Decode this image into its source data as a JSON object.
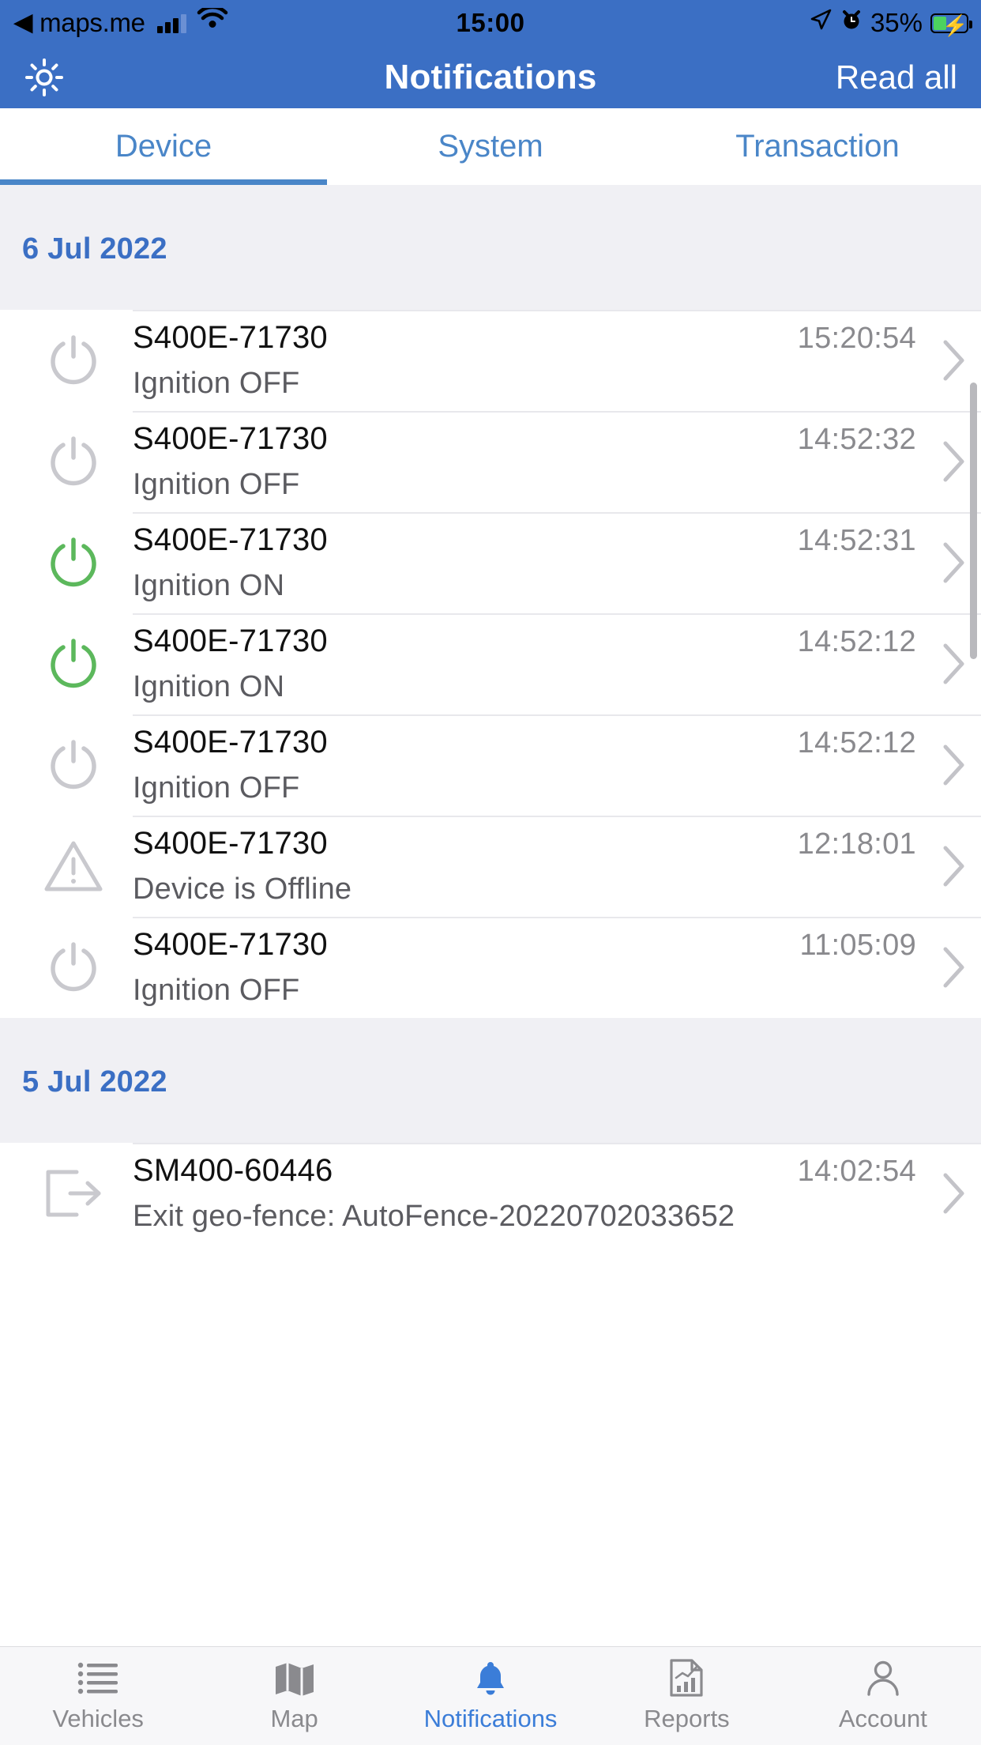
{
  "status_bar": {
    "back_arrow": "◀",
    "carrier_app": "maps.me",
    "signal_icon": "cellular-signal-icon",
    "wifi_icon": "wifi-icon",
    "time": "15:00",
    "location_icon": "location-arrow-icon",
    "alarm_icon": "alarm-clock-icon",
    "battery_percent": "35%",
    "battery_icon": "battery-charging-icon"
  },
  "nav_bar": {
    "settings_icon": "gear-icon",
    "title": "Notifications",
    "action_label": "Read all"
  },
  "tabs": [
    {
      "label": "Device",
      "active": true
    },
    {
      "label": "System",
      "active": false
    },
    {
      "label": "Transaction",
      "active": false
    }
  ],
  "sections": [
    {
      "date": "6 Jul 2022",
      "rows": [
        {
          "icon": "power-off-icon",
          "icon_color": "#c9c9ce",
          "device": "S400E-71730",
          "event": "Ignition OFF",
          "time": "15:20:54"
        },
        {
          "icon": "power-off-icon",
          "icon_color": "#c9c9ce",
          "device": "S400E-71730",
          "event": "Ignition OFF",
          "time": "14:52:32"
        },
        {
          "icon": "power-on-icon",
          "icon_color": "#5cb85c",
          "device": "S400E-71730",
          "event": "Ignition ON",
          "time": "14:52:31"
        },
        {
          "icon": "power-on-icon",
          "icon_color": "#5cb85c",
          "device": "S400E-71730",
          "event": "Ignition ON",
          "time": "14:52:12"
        },
        {
          "icon": "power-off-icon",
          "icon_color": "#c9c9ce",
          "device": "S400E-71730",
          "event": "Ignition OFF",
          "time": "14:52:12"
        },
        {
          "icon": "warning-icon",
          "icon_color": "#c9c9ce",
          "device": "S400E-71730",
          "event": "Device is Offline",
          "time": "12:18:01"
        },
        {
          "icon": "power-off-icon",
          "icon_color": "#c9c9ce",
          "device": "S400E-71730",
          "event": "Ignition OFF",
          "time": "11:05:09"
        }
      ]
    },
    {
      "date": "5 Jul 2022",
      "rows": [
        {
          "icon": "exit-geofence-icon",
          "icon_color": "#c9c9ce",
          "device": "SM400-60446",
          "event": "Exit geo-fence: AutoFence-20220702033652",
          "time": "14:02:54"
        }
      ]
    }
  ],
  "bottom_bar": [
    {
      "label": "Vehicles",
      "icon": "list-icon",
      "active": false
    },
    {
      "label": "Map",
      "icon": "map-icon",
      "active": false
    },
    {
      "label": "Notifications",
      "icon": "bell-icon",
      "active": true
    },
    {
      "label": "Reports",
      "icon": "report-chart-icon",
      "active": false
    },
    {
      "label": "Account",
      "icon": "person-icon",
      "active": false
    }
  ],
  "colors": {
    "brand_blue": "#3b6fc4",
    "tab_blue": "#4a86c8",
    "active_blue": "#3b7dd8",
    "green": "#5cb85c",
    "section_bg": "#f0f0f4"
  }
}
